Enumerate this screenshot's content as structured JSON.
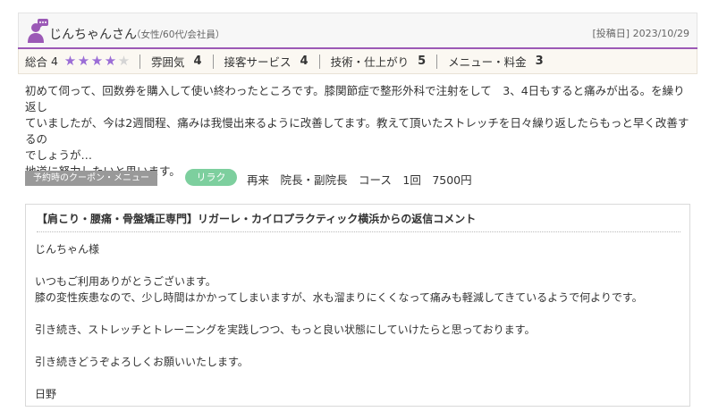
{
  "reviewer": {
    "name": "じんちゃんさん",
    "meta": "（女性/60代/会社員）",
    "post_date": "[投稿日] 2023/10/29"
  },
  "ratings": {
    "overall_label": "総合",
    "overall_score": "4",
    "stars_filled": 4,
    "stars_total": 5,
    "categories": [
      {
        "label": "雰囲気",
        "score": "4"
      },
      {
        "label": "接客サービス",
        "score": "4"
      },
      {
        "label": "技術・仕上がり",
        "score": "5"
      },
      {
        "label": "メニュー・料金",
        "score": "3"
      }
    ]
  },
  "review": {
    "lines": [
      "初めて伺って、回数券を購入して使い終わったところです。膝関節症で整形外科で注射をして　3、4日もすると痛みが出る。を繰り返し",
      "ていましたが、今は2週間程、痛みは我慢出来るように改善してます。教えて頂いたストレッチを日々繰り返したらもっと早く改善するの",
      "でしょうが…",
      "地道に努力したいと思います。"
    ]
  },
  "coupon": {
    "label": "予約時のクーポン・メニュー",
    "badge": "リラク",
    "text": "再来　院長・副院長　コース　1回　7500円"
  },
  "reply": {
    "title": "【肩こり・腰痛・骨盤矯正専門】リガーレ・カイロプラクティック横浜からの返信コメント",
    "lines": [
      "じんちゃん様",
      "いつもご利用ありがとうございます。",
      "膝の変性疾患なので、少し時間はかかってしまいますが、水も溜まりにくくなって痛みも軽減してきているようで何よりです。",
      "引き続き、ストレッチとトレーニングを実践しつつ、もっと良い状態にしていけたらと思っております。",
      "引き続きどうぞよろしくお願いいたします。",
      "日野"
    ]
  },
  "colors": {
    "accent_purple": "#9b59b6",
    "star_on": "#9b6dd6",
    "badge_green": "#7dcf9e"
  }
}
